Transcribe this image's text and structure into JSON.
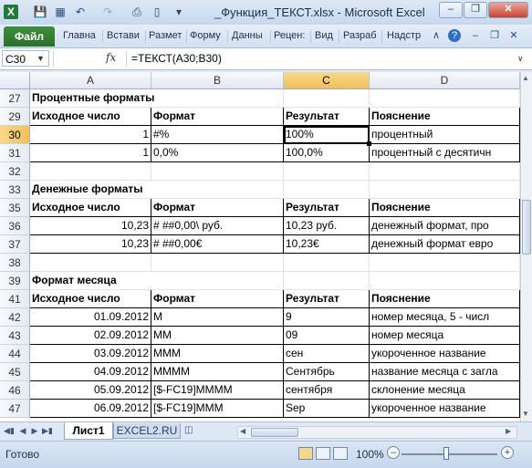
{
  "window": {
    "title": "_Функция_ТЕКСТ.xlsx - Microsoft Excel",
    "icons": [
      "excel-app-icon",
      "save-icon",
      "print-preview-icon",
      "undo-icon",
      "redo-icon",
      "quick-print-icon",
      "customize-icon"
    ]
  },
  "ribbon": {
    "file_tab": "Файл",
    "tabs": [
      "Главна",
      "Встави",
      "Размет",
      "Форму",
      "Данны",
      "Рецен:",
      "Вид",
      "Разраб",
      "Надстр"
    ]
  },
  "formula_bar": {
    "name_box": "C30",
    "fx_label": "fx",
    "formula": "=ТЕКСТ(A30;B30)"
  },
  "sheet": {
    "columns": [
      "A",
      "B",
      "C",
      "D"
    ],
    "selected_column": "C",
    "selected_row": "30",
    "rows": [
      {
        "num": "27",
        "cells": [
          "Процентные форматы",
          "",
          "",
          ""
        ],
        "type": "section"
      },
      {
        "num": "29",
        "cells": [
          "Исходное число",
          "Формат",
          "Результат",
          "Пояснение"
        ],
        "type": "header"
      },
      {
        "num": "30",
        "cells": [
          "1",
          "#%",
          "100%",
          "процентный"
        ],
        "type": "data"
      },
      {
        "num": "31",
        "cells": [
          "1",
          "0,0%",
          "100,0%",
          "процентный с десятичн"
        ],
        "type": "data"
      },
      {
        "num": "32",
        "cells": [
          "",
          "",
          "",
          ""
        ],
        "type": "blank"
      },
      {
        "num": "33",
        "cells": [
          "Денежные форматы",
          "",
          "",
          ""
        ],
        "type": "section"
      },
      {
        "num": "35",
        "cells": [
          "Исходное число",
          "Формат",
          "Результат",
          "Пояснение"
        ],
        "type": "header"
      },
      {
        "num": "36",
        "cells": [
          "10,23",
          "# ##0,00\\ руб.",
          "10,23 руб.",
          "денежный формат, про"
        ],
        "type": "data"
      },
      {
        "num": "37",
        "cells": [
          "10,23",
          "# ##0,00€",
          "10,23€",
          "денежный формат евро"
        ],
        "type": "data"
      },
      {
        "num": "38",
        "cells": [
          "",
          "",
          "",
          ""
        ],
        "type": "blank"
      },
      {
        "num": "39",
        "cells": [
          "Формат месяца",
          "",
          "",
          ""
        ],
        "type": "section"
      },
      {
        "num": "41",
        "cells": [
          "Исходное число",
          "Формат",
          "Результат",
          "Пояснение"
        ],
        "type": "header"
      },
      {
        "num": "42",
        "cells": [
          "01.09.2012",
          "М",
          "9",
          "номер месяца, 5 - числ"
        ],
        "type": "data"
      },
      {
        "num": "43",
        "cells": [
          "02.09.2012",
          "ММ",
          "09",
          "номер месяца"
        ],
        "type": "data"
      },
      {
        "num": "44",
        "cells": [
          "03.09.2012",
          "МММ",
          "сен",
          "укороченное название"
        ],
        "type": "data"
      },
      {
        "num": "45",
        "cells": [
          "04.09.2012",
          "ММММ",
          "Сентябрь",
          "название месяца с загла"
        ],
        "type": "data"
      },
      {
        "num": "46",
        "cells": [
          "05.09.2012",
          "[$-FC19]ММММ",
          "сентября",
          "склонение месяца"
        ],
        "type": "data"
      },
      {
        "num": "47",
        "cells": [
          "06.09.2012",
          "[$-FC19]МММ",
          "Sep",
          "укороченное название"
        ],
        "type": "data"
      }
    ]
  },
  "sheet_tabs": {
    "active": "Лист1",
    "other": "EXCEL2.RU"
  },
  "status": {
    "ready": "Готово",
    "zoom": "100%"
  }
}
